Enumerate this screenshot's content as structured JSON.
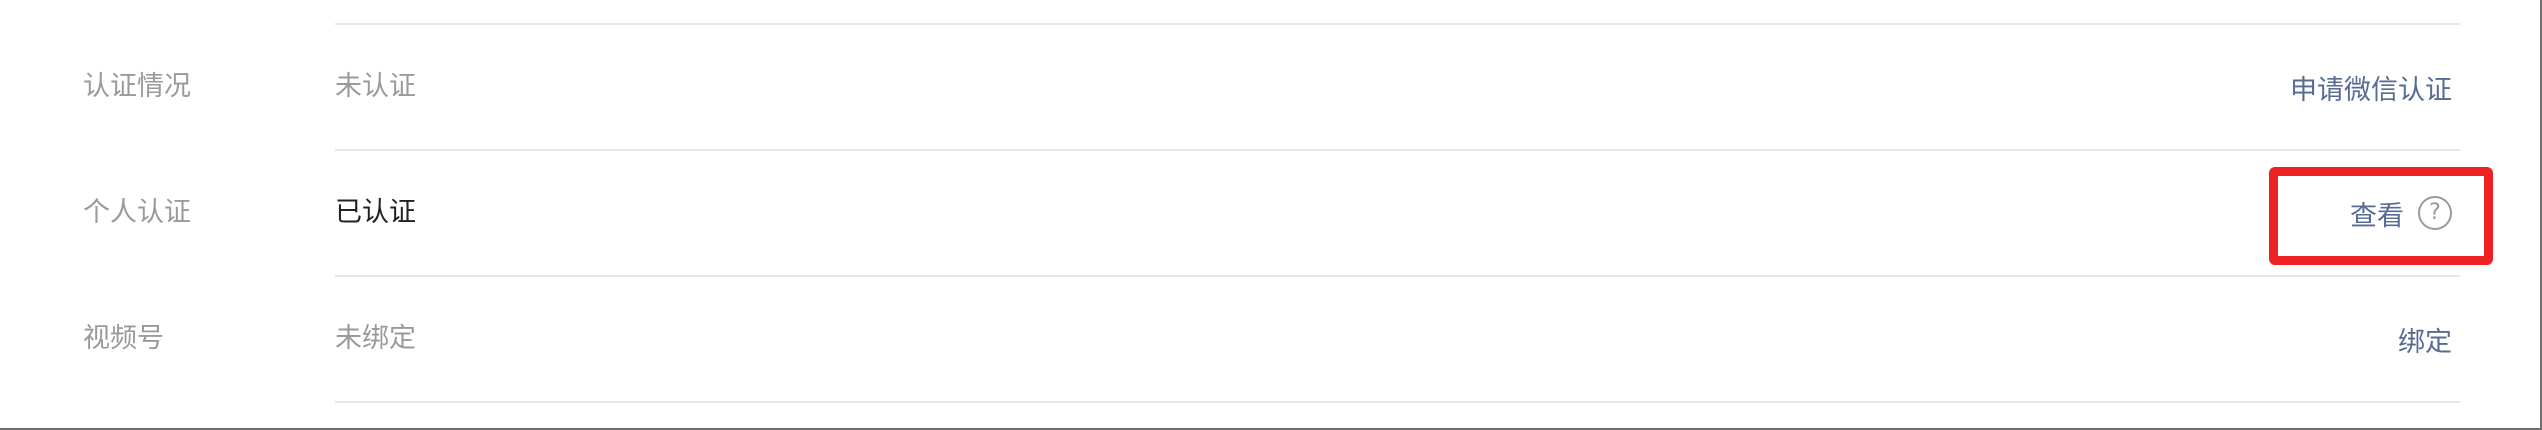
{
  "rows": [
    {
      "label": "认证情况",
      "value": "未认证",
      "action": "申请微信认证",
      "value_style": "muted"
    },
    {
      "label": "个人认证",
      "value": "已认证",
      "action": "查看",
      "action_icon": "question-circle-icon",
      "value_style": "strong"
    },
    {
      "label": "视频号",
      "value": "未绑定",
      "action": "绑定",
      "value_style": "muted"
    }
  ],
  "help_icon_glyph": "?",
  "colors": {
    "label": "#9a9a9a",
    "value_muted": "#9a9a9a",
    "value_strong": "#222222",
    "link": "#576b95",
    "divider": "#e7e7e7",
    "highlight": "#ee2222"
  }
}
